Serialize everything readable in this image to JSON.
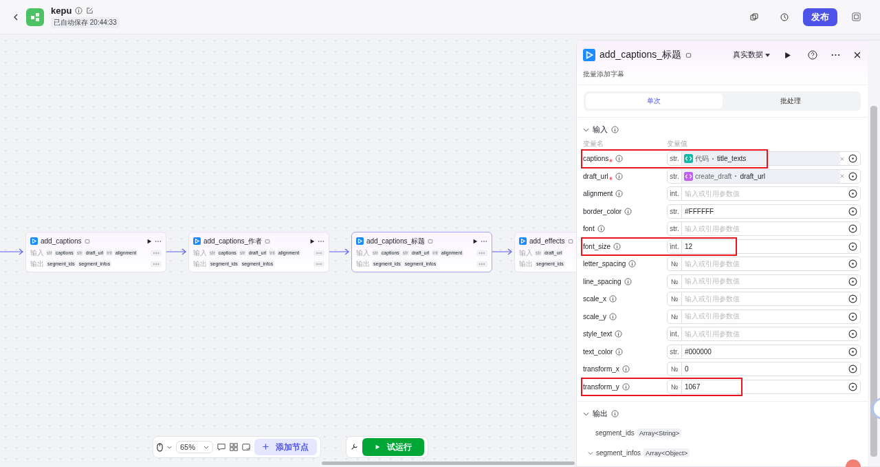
{
  "header": {
    "title": "kepu",
    "saved": "已自动保存 20:44:33",
    "publish": "发布"
  },
  "nodes": [
    {
      "title": "add_captions",
      "selected": false,
      "input_label": "输入",
      "output_label": "输出",
      "inputs": [
        {
          "type": "str",
          "name": "captions"
        },
        {
          "type": "str",
          "name": "draft_url"
        },
        {
          "type": "int",
          "name": "alignment"
        }
      ],
      "outputs": [
        "segment_ids",
        "segment_infos"
      ]
    },
    {
      "title": "add_captions_作者",
      "selected": false,
      "input_label": "输入",
      "output_label": "输出",
      "inputs": [
        {
          "type": "str",
          "name": "captions"
        },
        {
          "type": "str",
          "name": "draft_url"
        },
        {
          "type": "int",
          "name": "alignment"
        }
      ],
      "outputs": [
        "segment_ids",
        "segment_infos"
      ]
    },
    {
      "title": "add_captions_标题",
      "selected": true,
      "input_label": "输入",
      "output_label": "输出",
      "inputs": [
        {
          "type": "str",
          "name": "captions"
        },
        {
          "type": "str",
          "name": "draft_url"
        },
        {
          "type": "int",
          "name": "alignment"
        }
      ],
      "outputs": [
        "segment_ids",
        "segment_infos"
      ]
    },
    {
      "title": "add_effects",
      "selected": false,
      "input_label": "输入",
      "output_label": "输出",
      "inputs": [
        {
          "type": "str",
          "name": "draft_url"
        }
      ],
      "outputs": [
        "segment_ids"
      ]
    }
  ],
  "panel": {
    "title": "add_captions_标题",
    "subtitle": "批量添加字幕",
    "data_mode": "真实数据",
    "tabs": [
      {
        "label": "单次",
        "selected": true
      },
      {
        "label": "批处理",
        "selected": false
      }
    ],
    "input_section": "输入",
    "col_name": "变量名",
    "col_value": "变量值",
    "params": [
      {
        "name": "captions",
        "required": true,
        "type": "str.",
        "kind": "ref",
        "color": "#14b8a6",
        "source": "代码",
        "field": "title_texts",
        "highlighted": true
      },
      {
        "name": "draft_url",
        "required": true,
        "type": "str.",
        "kind": "ref",
        "color": "#c060f0",
        "source": "create_draft",
        "field": "draft_url",
        "highlighted": false
      },
      {
        "name": "alignment",
        "required": false,
        "type": "int.",
        "kind": "input",
        "placeholder": "输入或引用参数值",
        "highlighted": false
      },
      {
        "name": "border_color",
        "required": false,
        "type": "str.",
        "kind": "input",
        "value": "#FFFFFF",
        "highlighted": false
      },
      {
        "name": "font",
        "required": false,
        "type": "str.",
        "kind": "input",
        "placeholder": "输入或引用参数值",
        "highlighted": false
      },
      {
        "name": "font_size",
        "required": false,
        "type": "int.",
        "kind": "input",
        "value": "12",
        "highlighted": true
      },
      {
        "name": "letter_spacing",
        "required": false,
        "type": "№",
        "kind": "input",
        "placeholder": "输入或引用参数值",
        "highlighted": false
      },
      {
        "name": "line_spacing",
        "required": false,
        "type": "№",
        "kind": "input",
        "placeholder": "输入或引用参数值",
        "highlighted": false
      },
      {
        "name": "scale_x",
        "required": false,
        "type": "№",
        "kind": "input",
        "placeholder": "输入或引用参数值",
        "highlighted": false
      },
      {
        "name": "scale_y",
        "required": false,
        "type": "№",
        "kind": "input",
        "placeholder": "输入或引用参数值",
        "highlighted": false
      },
      {
        "name": "style_text",
        "required": false,
        "type": "int.",
        "kind": "input",
        "placeholder": "输入或引用参数值",
        "highlighted": false
      },
      {
        "name": "text_color",
        "required": false,
        "type": "str.",
        "kind": "input",
        "value": "#000000",
        "highlighted": false
      },
      {
        "name": "transform_x",
        "required": false,
        "type": "№",
        "kind": "input",
        "value": "0",
        "highlighted": false
      },
      {
        "name": "transform_y",
        "required": false,
        "type": "№",
        "kind": "input",
        "value": "1067",
        "highlighted": true
      }
    ],
    "output_section": "输出",
    "outputs": [
      {
        "name": "segment_ids",
        "type": "Array<String>",
        "expanded": false
      },
      {
        "name": "segment_infos",
        "type": "Array<Object>",
        "expanded": true
      }
    ]
  },
  "toolbar": {
    "zoom": "65%",
    "add_node": "添加节点",
    "test_run": "试运行"
  }
}
